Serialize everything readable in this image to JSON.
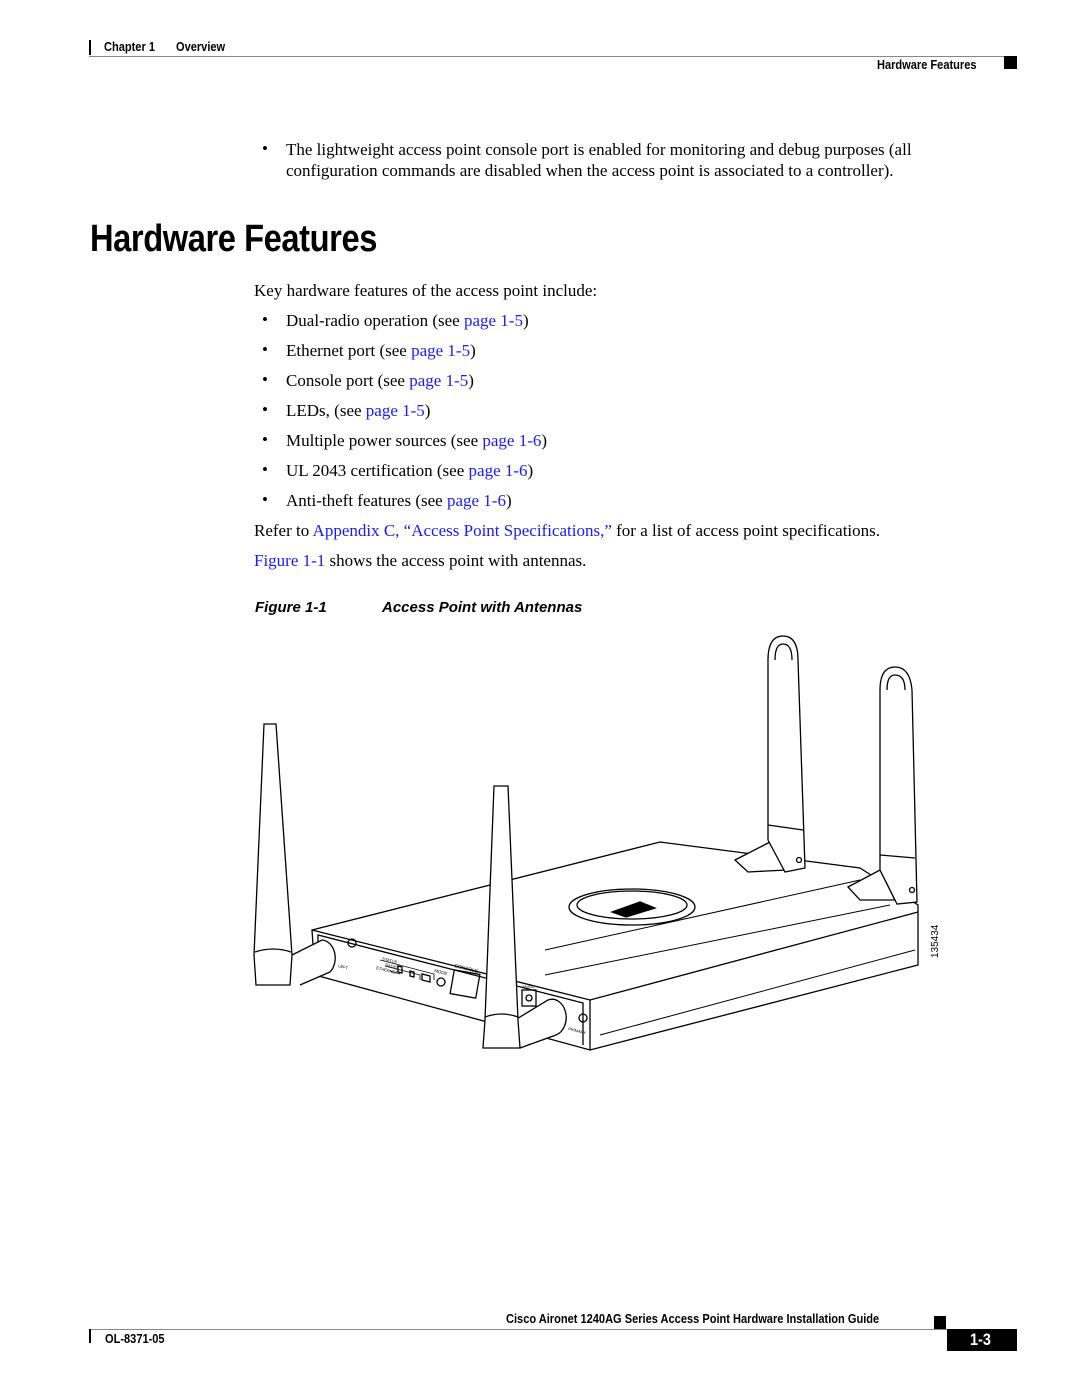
{
  "header": {
    "chapter": "Chapter 1",
    "chapter_title": "Overview",
    "section": "Hardware Features"
  },
  "intro_bullet": [
    "The lightweight access point console port is enabled for monitoring and debug purposes (all",
    "configuration commands are disabled when the access point is associated to a controller)."
  ],
  "section_title": "Hardware Features",
  "lead": "Key hardware features of the access point include:",
  "features": [
    {
      "text": "Dual-radio operation (see ",
      "link": "page 1-5",
      "end": ")"
    },
    {
      "text": "Ethernet port (see ",
      "link": "page 1-5",
      "end": ")"
    },
    {
      "text": "Console port (see ",
      "link": "page 1-5",
      "end": ")"
    },
    {
      "text": "LEDs, (see ",
      "link": "page 1-5",
      "end": ")"
    },
    {
      "text": "Multiple power sources (see ",
      "link": "page 1-6",
      "end": ")"
    },
    {
      "text": "UL 2043 certification (see ",
      "link": "page 1-6",
      "end": ")"
    },
    {
      "text": "Anti-theft features (see ",
      "link": "page 1-6",
      "end": ")"
    }
  ],
  "refer": {
    "pre": "Refer to ",
    "link": "Appendix C, “Access Point Specifications,”",
    "post": " for a list of access point specifications."
  },
  "figref": {
    "link": "Figure 1-1",
    "post": " shows the access point with antennas."
  },
  "figure": {
    "number": "Figure 1-1",
    "title": "Access Point with Antennas",
    "id": "135434",
    "labels": {
      "status": "STATUS",
      "radio": "RADIO",
      "ethernet": "ETHERNET",
      "mode": "MODE",
      "console": "CONSOLE",
      "power": "48VDC",
      "left": "LEFT",
      "primary": "PRIMARY"
    }
  },
  "footer": {
    "guide_title": "Cisco Aironet 1240AG Series Access Point Hardware Installation Guide",
    "doc_number": "OL-8371-05",
    "page_number": "1-3"
  }
}
